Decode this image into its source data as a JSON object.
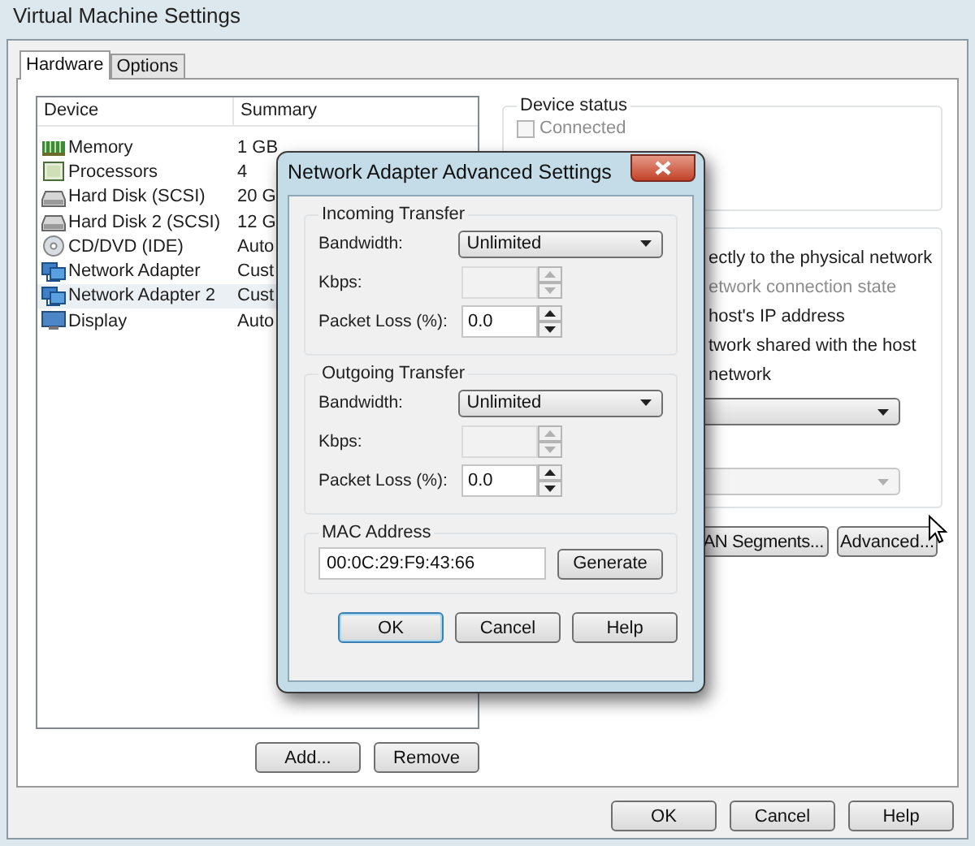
{
  "window": {
    "title": "Virtual Machine Settings"
  },
  "tabs": [
    {
      "label": "Hardware",
      "selected": true
    },
    {
      "label": "Options",
      "selected": false
    }
  ],
  "device_list": {
    "columns": [
      "Device",
      "Summary"
    ],
    "rows": [
      {
        "kind": "memory",
        "device": "Memory",
        "summary": "1 GB",
        "selected": false
      },
      {
        "kind": "processor",
        "device": "Processors",
        "summary": "4",
        "selected": false
      },
      {
        "kind": "disk",
        "device": "Hard Disk (SCSI)",
        "summary": "20 G",
        "selected": false
      },
      {
        "kind": "disk",
        "device": "Hard Disk 2 (SCSI)",
        "summary": "12 G",
        "selected": false
      },
      {
        "kind": "cd",
        "device": "CD/DVD (IDE)",
        "summary": "Auto",
        "selected": false
      },
      {
        "kind": "network",
        "device": "Network Adapter",
        "summary": "Cust",
        "selected": false
      },
      {
        "kind": "network",
        "device": "Network Adapter 2",
        "summary": "Cust",
        "selected": true
      },
      {
        "kind": "display",
        "device": "Display",
        "summary": "Auto",
        "selected": false
      }
    ]
  },
  "list_buttons": [
    "Add...",
    "Remove"
  ],
  "device_status": {
    "title": "Device status",
    "options": [
      {
        "label": "Connected",
        "checked": false,
        "disabled": true
      }
    ]
  },
  "network_connection": {
    "options": [
      {
        "label": "ectly to the physical network",
        "disabled": false
      },
      {
        "label": "etwork connection state",
        "disabled": true
      },
      {
        "label": "host's IP address",
        "disabled": false
      },
      {
        "label": "twork shared with the host",
        "disabled": false
      },
      {
        "label": "network",
        "disabled": false
      }
    ],
    "dropdowns": [
      {
        "disabled": false
      },
      {
        "disabled": true
      }
    ],
    "buttons": [
      "AN Segments...",
      "Advanced..."
    ]
  },
  "dialog": {
    "title": "Network Adapter Advanced Settings",
    "groups": [
      {
        "title": "Incoming Transfer",
        "fields": [
          {
            "kind": "select",
            "label": "Bandwidth:",
            "value": "Unlimited"
          },
          {
            "kind": "spin",
            "label": "Kbps:",
            "disabled": true
          },
          {
            "kind": "spin",
            "label": "Packet Loss (%):",
            "value": "0.0",
            "disabled": false
          }
        ]
      },
      {
        "title": "Outgoing Transfer",
        "fields": [
          {
            "kind": "select",
            "label": "Bandwidth:",
            "value": "Unlimited"
          },
          {
            "kind": "spin",
            "label": "Kbps:",
            "disabled": true
          },
          {
            "kind": "spin",
            "label": "Packet Loss (%):",
            "value": "0.0",
            "disabled": false
          }
        ]
      }
    ],
    "mac": {
      "title": "MAC Address",
      "value": "00:0C:29:F9:43:66",
      "button": "Generate"
    },
    "buttons": [
      {
        "label": "OK",
        "focused": true
      },
      {
        "label": "Cancel",
        "focused": false
      },
      {
        "label": "Help",
        "focused": false
      }
    ]
  },
  "footer_buttons": [
    "OK",
    "Cancel",
    "Help"
  ]
}
